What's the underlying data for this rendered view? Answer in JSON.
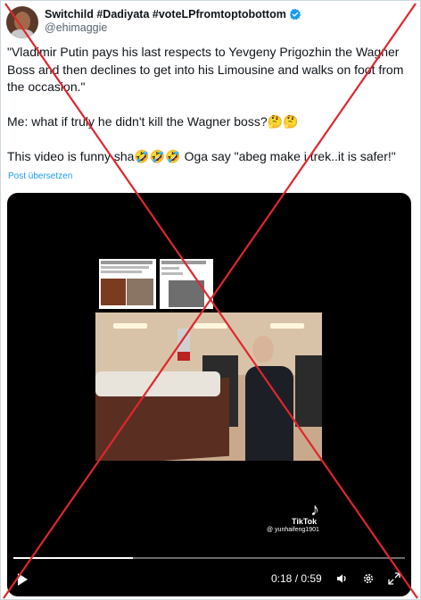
{
  "tweet": {
    "display_name": "Switchild #Dadiyata #voteLPfromtoptobottom",
    "handle": "@ehimaggie",
    "text_lines": [
      "\"Vladimir Putin pays his last respects to Yevgeny Prigozhin the Wagner Boss and then declines to get into his Limousine and walks on foot from the occasion.\"",
      "Me: what if truly he didn't kill the Wagner boss?🤔🤔",
      "This video is funny sha🤣🤣🤣 Oga say \"abeg make i trek..it is safer!\""
    ],
    "translate_label": "Post übersetzen"
  },
  "video": {
    "tiktok_logo": "♪",
    "tiktok_name": "TikTok",
    "tiktok_user": "@ yunhaifeng1901",
    "current_time": "0:18",
    "duration": "0:59",
    "time_display": "0:18 / 0:59",
    "progress": 0.305
  },
  "icons": {
    "play": "play-icon",
    "volume": "volume-icon",
    "settings": "gear-icon",
    "fullscreen": "fullscreen-icon",
    "verified": "verified-icon"
  },
  "colors": {
    "accent": "#1d9bf0",
    "cross": "#e0262c",
    "text": "#0f1419",
    "muted": "#536471"
  }
}
